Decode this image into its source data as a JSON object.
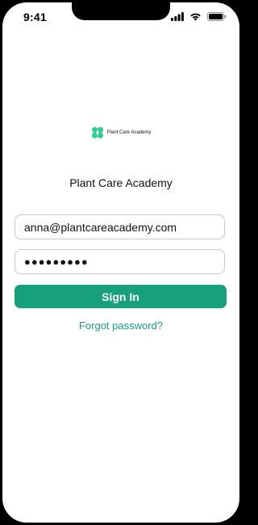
{
  "status_bar": {
    "time": "9:41",
    "signal_icon": "signal-bars-icon",
    "wifi_icon": "wifi-icon",
    "battery_icon": "battery-icon"
  },
  "brand": {
    "logo_icon": "plant-logo-icon",
    "logo_text": "Plant Care Academy",
    "accent_color": "#16a07c"
  },
  "page": {
    "title": "Plant Care Academy"
  },
  "form": {
    "email_value": "anna@plantcareacademy.com",
    "password_value": "●●●●●●●●●",
    "signin_label": "Sign In",
    "forgot_label": "Forgot password?"
  }
}
